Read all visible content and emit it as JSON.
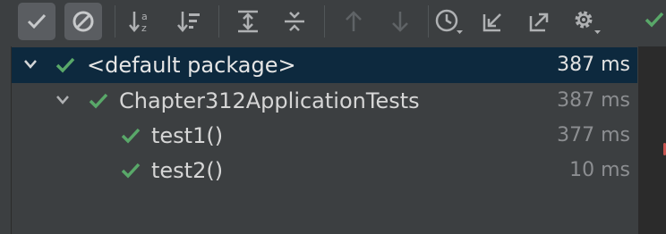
{
  "toolbar": {
    "buttons": [
      {
        "name": "show-passed-button",
        "icon": "check-icon",
        "toggled": true
      },
      {
        "name": "show-ignored-button",
        "icon": "ban-icon",
        "toggled": true
      },
      {
        "name": "sort-alphabetically-button",
        "icon": "sort-alpha-icon"
      },
      {
        "name": "sort-by-duration-button",
        "icon": "sort-duration-icon"
      },
      {
        "name": "expand-all-button",
        "icon": "expand-all-icon"
      },
      {
        "name": "collapse-all-button",
        "icon": "collapse-all-icon"
      },
      {
        "name": "previous-failed-button",
        "icon": "arrow-up-icon",
        "disabled": true
      },
      {
        "name": "next-failed-button",
        "icon": "arrow-down-icon",
        "disabled": true
      },
      {
        "name": "test-history-button",
        "icon": "clock-icon"
      },
      {
        "name": "import-tests-button",
        "icon": "import-icon"
      },
      {
        "name": "export-tests-button",
        "icon": "export-icon"
      },
      {
        "name": "settings-button",
        "icon": "gear-icon"
      }
    ]
  },
  "colors": {
    "pass": "#59a869",
    "selection": "#0d293e",
    "panel": "#3c3f41",
    "icon": "#afb1b3",
    "icon_disabled": "#5f6366"
  },
  "tree": [
    {
      "label": "<default package>",
      "time": "387 ms",
      "status": "passed",
      "expanded": true,
      "selected": true
    },
    {
      "label": "Chapter312ApplicationTests",
      "time": "387 ms",
      "status": "passed",
      "expanded": true
    },
    {
      "label": "test1()",
      "time": "377 ms",
      "status": "passed"
    },
    {
      "label": "test2()",
      "time": "10 ms",
      "status": "passed"
    }
  ]
}
